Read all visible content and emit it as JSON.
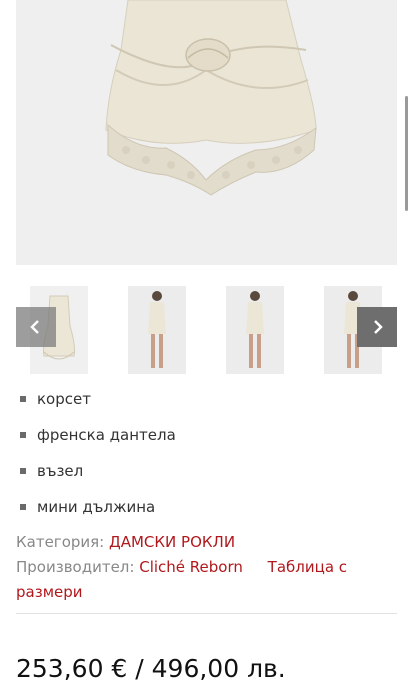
{
  "gallery": {
    "main_image_alt": "dress-skirt-detail",
    "thumbnails": [
      "thumb-1",
      "thumb-2",
      "thumb-3",
      "thumb-4"
    ],
    "prev_icon": "chevron-left-icon",
    "next_icon": "chevron-right-icon"
  },
  "features": [
    "корсет",
    "френска дантела",
    "възел",
    "мини дължина"
  ],
  "meta": {
    "category_label": "Категория:",
    "category_value": "ДАМСКИ РОКЛИ",
    "manufacturer_label": "Производител:",
    "manufacturer_value": "Cliché Reborn",
    "size_chart_line1": "Таблица с",
    "size_chart_line2": "размери"
  },
  "price": "253,60 € / 496,00 лв.",
  "colors": {
    "link": "#b1181c",
    "cream": "#ece6d6",
    "image_bg": "#efefef"
  }
}
